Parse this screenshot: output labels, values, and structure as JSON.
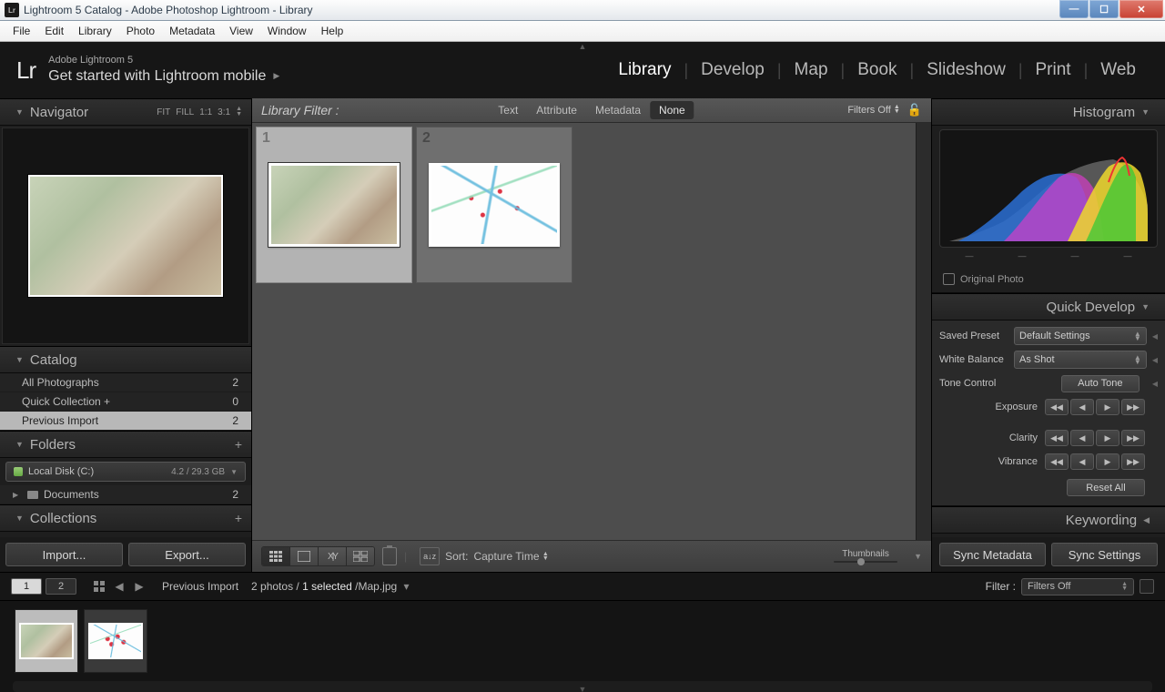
{
  "window": {
    "title": "Lightroom 5 Catalog - Adobe Photoshop Lightroom - Library",
    "app_icon": "Lr"
  },
  "os_menu": [
    "File",
    "Edit",
    "Library",
    "Photo",
    "Metadata",
    "View",
    "Window",
    "Help"
  ],
  "brand": {
    "logo": "Lr",
    "line1": "Adobe Lightroom 5",
    "line2": "Get started with Lightroom mobile"
  },
  "modules": [
    "Library",
    "Develop",
    "Map",
    "Book",
    "Slideshow",
    "Print",
    "Web"
  ],
  "module_selected": "Library",
  "navigator": {
    "title": "Navigator",
    "zoom_opts": [
      "FIT",
      "FILL",
      "1:1",
      "3:1"
    ]
  },
  "catalog": {
    "title": "Catalog",
    "rows": [
      {
        "label": "All Photographs",
        "count": 2,
        "sel": false
      },
      {
        "label": "Quick Collection  +",
        "count": 0,
        "sel": false
      },
      {
        "label": "Previous Import",
        "count": 2,
        "sel": true
      }
    ]
  },
  "folders": {
    "title": "Folders",
    "drive": {
      "label": "Local Disk (C:)",
      "space": "4.2 / 29.3 GB"
    },
    "items": [
      {
        "label": "Documents",
        "count": 2
      }
    ]
  },
  "collections": {
    "title": "Collections"
  },
  "left_buttons": {
    "import": "Import...",
    "export": "Export..."
  },
  "library_filter": {
    "label": "Library Filter :",
    "tabs": [
      "Text",
      "Attribute",
      "Metadata",
      "None"
    ],
    "selected": "None",
    "filters_state": "Filters Off"
  },
  "grid": {
    "items": [
      {
        "idx": 1,
        "sel": true,
        "style": "map-a"
      },
      {
        "idx": 2,
        "sel": false,
        "style": "map-b"
      }
    ]
  },
  "grid_toolbar": {
    "sort_label": "Sort:",
    "sort_value": "Capture Time",
    "thumb_label": "Thumbnails"
  },
  "histogram": {
    "title": "Histogram",
    "meta": [
      "—",
      "—",
      "—",
      "—"
    ],
    "original_label": "Original Photo"
  },
  "quick_develop": {
    "title": "Quick Develop",
    "saved_preset": {
      "label": "Saved Preset",
      "value": "Default Settings"
    },
    "white_balance": {
      "label": "White Balance",
      "value": "As Shot"
    },
    "tone_control": {
      "label": "Tone Control",
      "auto": "Auto Tone"
    },
    "sliders": [
      "Exposure",
      "Clarity",
      "Vibrance"
    ],
    "reset": "Reset All"
  },
  "keywording": {
    "title": "Keywording"
  },
  "sync": {
    "meta": "Sync Metadata",
    "settings": "Sync Settings"
  },
  "status": {
    "displays": [
      "1",
      "2"
    ],
    "breadcrumb": "Previous Import",
    "count_text": "2 photos /",
    "selected_text": "1 selected",
    "file": " /Map.jpg",
    "filter_label": "Filter :",
    "filter_value": "Filters Off"
  },
  "filmstrip": {
    "items": [
      {
        "sel": true,
        "style": "map-a"
      },
      {
        "sel": false,
        "style": "map-b"
      }
    ]
  }
}
